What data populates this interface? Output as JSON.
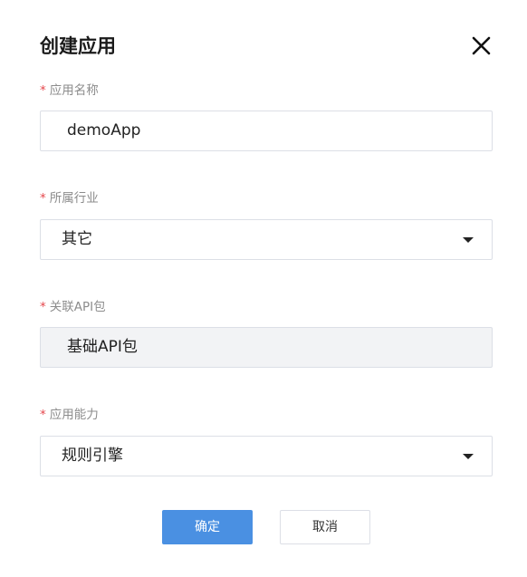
{
  "dialog": {
    "title": "创建应用",
    "close_icon": "close-icon"
  },
  "fields": {
    "app_name": {
      "required_mark": "*",
      "label": "应用名称",
      "value": "demoApp"
    },
    "industry": {
      "required_mark": "*",
      "label": "所属行业",
      "value": "其它",
      "dropdown_icon": "caret-down-icon"
    },
    "api_package": {
      "required_mark": "*",
      "label": "关联API包",
      "value": "基础API包"
    },
    "capability": {
      "required_mark": "*",
      "label": "应用能力",
      "value": "规则引擎",
      "dropdown_icon": "caret-down-icon"
    }
  },
  "buttons": {
    "confirm": "确定",
    "cancel": "取消"
  },
  "colors": {
    "primary": "#4a90e2",
    "required": "#e5484d",
    "label": "#8c8c8c",
    "border": "#dcdfe6",
    "disabled_bg": "#f2f3f5"
  }
}
